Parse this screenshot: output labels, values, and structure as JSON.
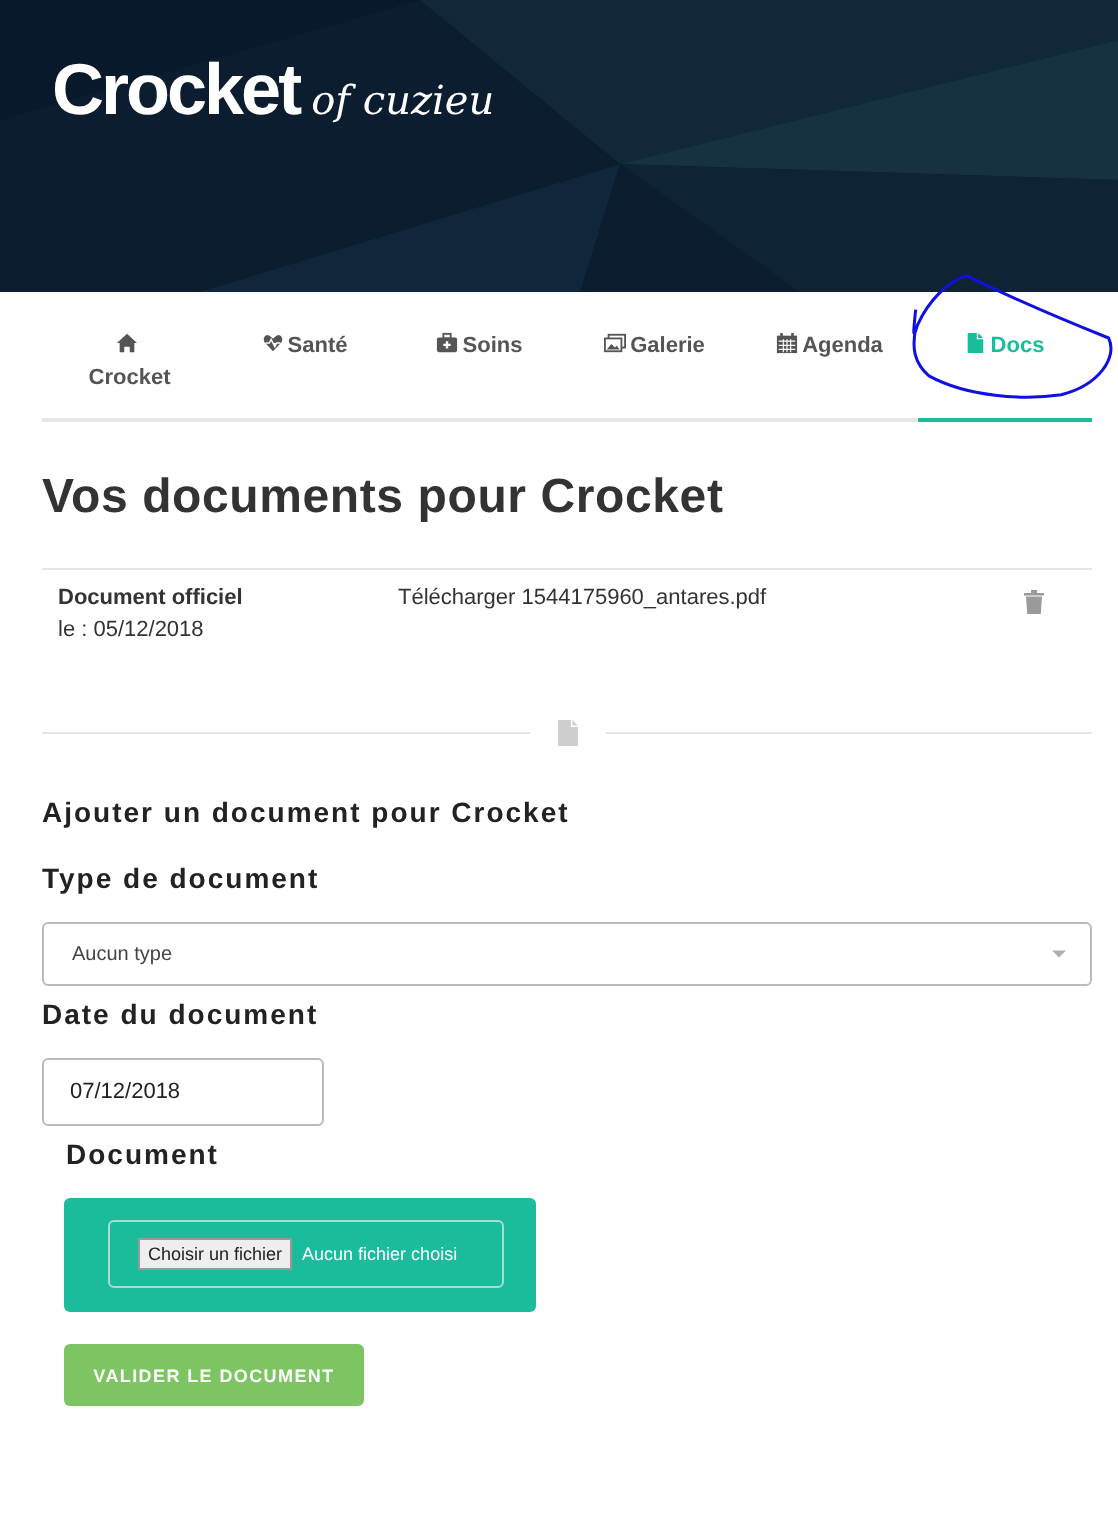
{
  "header": {
    "logo": "Crocket",
    "logo_suffix": "of cuzieu"
  },
  "tabs": [
    {
      "label": "Crocket",
      "selected": false
    },
    {
      "label": "Santé",
      "selected": false
    },
    {
      "label": "Soins",
      "selected": false
    },
    {
      "label": "Galerie",
      "selected": false
    },
    {
      "label": "Agenda",
      "selected": false
    },
    {
      "label": "Docs",
      "selected": true
    }
  ],
  "title": "Vos documents pour Crocket",
  "documents": [
    {
      "type": "Document officiel",
      "date": "le : 05/12/2018",
      "link": "Télécharger 1544175960_antares.pdf"
    }
  ],
  "form": {
    "title": "Ajouter un document pour Crocket",
    "type_label": "Type de document",
    "type_value": "Aucun type",
    "date_label": "Date du document",
    "date_value": "07/12/2018",
    "file_label": "Document",
    "file_button": "Choisir un fichier",
    "file_status": "Aucun fichier choisi",
    "submit": "VALIDER LE DOCUMENT"
  }
}
